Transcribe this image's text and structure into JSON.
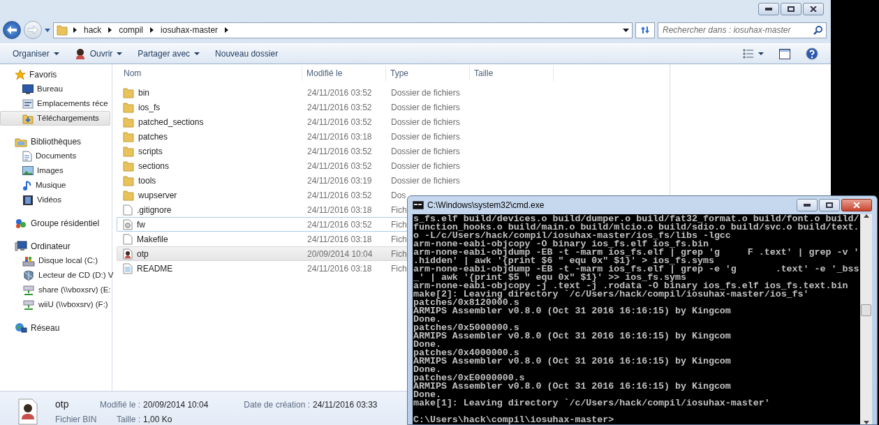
{
  "explorer": {
    "breadcrumb": [
      "hack",
      "compil",
      "iosuhax-master"
    ],
    "search": {
      "placeholder": "Rechercher dans : iosuhax-master"
    },
    "toolbar": [
      {
        "label": "Organiser",
        "kind": "menu"
      },
      {
        "label": "Ouvrir",
        "kind": "app-menu"
      },
      {
        "label": "Partager avec",
        "kind": "menu"
      },
      {
        "label": "Nouveau dossier",
        "kind": "button"
      }
    ],
    "sidebar": [
      {
        "label": "Favoris",
        "selected": false,
        "children": [
          {
            "label": "Bureau",
            "selected": false
          },
          {
            "label": "Emplacements réce",
            "selected": false
          },
          {
            "label": "Téléchargements",
            "selected": true
          }
        ]
      },
      {
        "label": "Bibliothèques",
        "selected": false,
        "children": [
          {
            "label": "Documents",
            "selected": false
          },
          {
            "label": "Images",
            "selected": false
          },
          {
            "label": "Musique",
            "selected": false
          },
          {
            "label": "Vidéos",
            "selected": false
          }
        ]
      },
      {
        "label": "Groupe résidentiel",
        "selected": false
      },
      {
        "label": "Ordinateur",
        "selected": false,
        "children": [
          {
            "label": "Disque local (C:)",
            "selected": false
          },
          {
            "label": "Lecteur de CD (D:) V",
            "selected": false
          },
          {
            "label": "share (\\\\vboxsrv) (E:",
            "selected": false
          },
          {
            "label": "wiiU (\\\\vboxsrv) (F:)",
            "selected": false
          }
        ]
      },
      {
        "label": "Réseau",
        "selected": false
      }
    ],
    "columns": [
      "Nom",
      "Modifié le",
      "Type",
      "Taille"
    ],
    "files": [
      {
        "name": "bin",
        "kind": "folder",
        "modified": "24/11/2016 03:52",
        "type": "Dossier de fichiers",
        "selected": false,
        "focused": false
      },
      {
        "name": "ios_fs",
        "kind": "folder",
        "modified": "24/11/2016 03:52",
        "type": "Dossier de fichiers",
        "selected": false,
        "focused": false
      },
      {
        "name": "patched_sections",
        "kind": "folder",
        "modified": "24/11/2016 03:52",
        "type": "Dossier de fichiers",
        "selected": false,
        "focused": false
      },
      {
        "name": "patches",
        "kind": "folder",
        "modified": "24/11/2016 03:18",
        "type": "Dossier de fichiers",
        "selected": false,
        "focused": false
      },
      {
        "name": "scripts",
        "kind": "folder",
        "modified": "24/11/2016 03:52",
        "type": "Dossier de fichiers",
        "selected": false,
        "focused": false
      },
      {
        "name": "sections",
        "kind": "folder",
        "modified": "24/11/2016 03:52",
        "type": "Dossier de fichiers",
        "selected": false,
        "focused": false
      },
      {
        "name": "tools",
        "kind": "folder",
        "modified": "24/11/2016 03:19",
        "type": "Dossier de fichiers",
        "selected": false,
        "focused": false
      },
      {
        "name": "wupserver",
        "kind": "folder",
        "modified": "24/11/2016 03:52",
        "type": "Dos",
        "selected": false,
        "focused": false
      },
      {
        "name": ".gitignore",
        "kind": "file",
        "modified": "24/11/2016 03:18",
        "type": "Fich",
        "selected": false,
        "focused": false
      },
      {
        "name": "fw",
        "kind": "settings",
        "modified": "24/11/2016 03:52",
        "type": "Fich",
        "selected": false,
        "focused": true
      },
      {
        "name": "Makefile",
        "kind": "file",
        "modified": "24/11/2016 03:18",
        "type": "Fich",
        "selected": false,
        "focused": false
      },
      {
        "name": "otp",
        "kind": "image",
        "modified": "20/09/2014 10:04",
        "type": "Fich",
        "selected": true,
        "focused": false
      },
      {
        "name": "README",
        "kind": "text",
        "modified": "24/11/2016 03:18",
        "type": "Fich",
        "selected": false,
        "focused": false
      }
    ],
    "details": {
      "name": "otp",
      "type": "Fichier BIN",
      "fields": [
        {
          "label": "Modifié le :",
          "value": "20/09/2014 10:04"
        },
        {
          "label": "Date de création :",
          "value": "24/11/2016 03:33"
        },
        {
          "label": "Taille :",
          "value": "1,00 Ko"
        }
      ]
    }
  },
  "console": {
    "title": "C:\\Windows\\system32\\cmd.exe",
    "lines": [
      "s_fs.elf build/devices.o build/dumper.o build/fat32_format.o build/font.o build/",
      "function_hooks.o build/main.o build/mlcio.o build/sdio.o build/svc.o build/text.",
      "o -L/c/Users/hack/compil/iosuhax-master/ios_fs/libs -lgcc",
      "arm-none-eabi-objcopy -O binary ios_fs.elf ios_fs.bin",
      "arm-none-eabi-objdump -EB -t -marm ios_fs.elf | grep 'g     F .text' | grep -v '",
      ".hidden' | awk '{print $6 \" equ 0x\" $1}' > ios_fs.syms",
      "arm-none-eabi-objdump -EB -t -marm ios_fs.elf | grep -e 'g       .text' -e '_bss",
      "_' | awk '{print $5 \" equ 0x\" $1}' >> ios_fs.syms",
      "arm-none-eabi-objcopy -j .text -j .rodata -O binary ios_fs.elf ios_fs.text.bin",
      "make[2]: Leaving directory `/c/Users/hack/compil/iosuhax-master/ios_fs'",
      "patches/0x8120000.s",
      "ARMIPS Assembler v0.8.0 (Oct 31 2016 16:16:15) by Kingcom",
      "Done.",
      "patches/0x5000000.s",
      "ARMIPS Assembler v0.8.0 (Oct 31 2016 16:16:15) by Kingcom",
      "Done.",
      "patches/0x4000000.s",
      "ARMIPS Assembler v0.8.0 (Oct 31 2016 16:16:15) by Kingcom",
      "Done.",
      "patches/0xE0000000.s",
      "ARMIPS Assembler v0.8.0 (Oct 31 2016 16:16:15) by Kingcom",
      "Done.",
      "make[1]: Leaving directory `/c/Users/hack/compil/iosuhax-master'"
    ],
    "prompt": "C:\\Users\\hack\\compil\\iosuhax-master>"
  }
}
